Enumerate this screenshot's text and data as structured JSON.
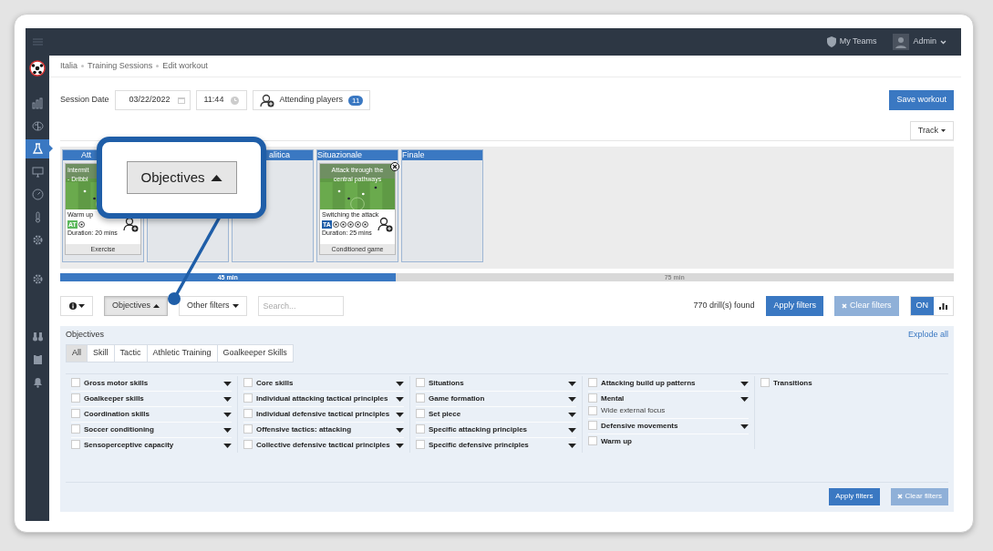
{
  "sidebar": {
    "items": [
      {
        "kind": "chart",
        "selected": false
      },
      {
        "kind": "brain",
        "selected": false
      },
      {
        "kind": "flask",
        "selected": true
      },
      {
        "kind": "monitor",
        "selected": false
      },
      {
        "kind": "gauge",
        "selected": false
      },
      {
        "kind": "thermometer",
        "selected": false
      },
      {
        "kind": "gear",
        "selected": false
      }
    ],
    "lower_items": [
      {
        "kind": "gear",
        "selected": false
      }
    ],
    "bottom_items": [
      {
        "kind": "binoculars",
        "selected": false
      },
      {
        "kind": "clipboard",
        "selected": false
      },
      {
        "kind": "bell",
        "selected": false
      }
    ]
  },
  "topbar": {
    "my_teams": "My Teams",
    "user": "Admin"
  },
  "breadcrumb": [
    "Italia",
    "Training Sessions",
    "Edit workout"
  ],
  "session": {
    "label": "Session Date",
    "date": "03/22/2022",
    "time": "11:44",
    "attending_label": "Attending players",
    "attending_count": "11"
  },
  "save_button": "Save workout",
  "track_button": "Track",
  "phases": [
    {
      "kind": "column",
      "title": "Att",
      "drills": [
        {
          "title_lines": [
            "Intermit",
            "- Dribbl"
          ],
          "category": "Warm up",
          "tag": "AT",
          "color": "#5cb85c",
          "icons": [
            {
              "kind": "ball"
            }
          ],
          "duration": "Duration: 20 mins",
          "type": "Exercise",
          "removable": false
        }
      ]
    },
    {
      "kind": "column"
    },
    {
      "kind": "column",
      "title": "alitica"
    },
    {
      "kind": "column",
      "title": "Situazionale",
      "drills": [
        {
          "title_lines": [
            "Attack through the",
            "central pathways"
          ],
          "category": "Switching the attack",
          "tag": "TA",
          "color": "#1f5ea8",
          "icons": [
            {
              "kind": "ball"
            },
            {
              "kind": "ball"
            },
            {
              "kind": "ball"
            },
            {
              "kind": "ball"
            },
            {
              "kind": "ball"
            }
          ],
          "duration": "Duration: 25 mins",
          "type": "Conditioned game",
          "removable": true
        }
      ]
    },
    {
      "kind": "column",
      "title": "Finale"
    }
  ],
  "duration_bar": {
    "level": 0.375,
    "done_label": "45 min",
    "total_label": "75 min"
  },
  "callout": {
    "label": "Objectives"
  },
  "filters": {
    "objectives_label": "Objectives",
    "objectives_open": true,
    "other_label": "Other filters",
    "search_placeholder": "Search...",
    "found": "770 drill(s) found",
    "apply": "Apply filters",
    "clear": "Clear filters",
    "toggle": {
      "label": "ON",
      "on": true
    }
  },
  "objectives_panel": {
    "title": "Objectives",
    "explode": "Explode all",
    "tabs": [
      {
        "label": "All",
        "selected": true
      },
      {
        "label": "Skill",
        "selected": false
      },
      {
        "label": "Tactic",
        "selected": false
      },
      {
        "label": "Athletic Training",
        "selected": false
      },
      {
        "label": "Goalkeeper Skills",
        "selected": false
      }
    ],
    "columns": [
      [
        {
          "label": "Gross motor skills",
          "checked": false,
          "expandable": true
        },
        {
          "label": "Goalkeeper skills",
          "checked": false,
          "expandable": true
        },
        {
          "label": "Coordination skills",
          "checked": false,
          "expandable": true
        },
        {
          "label": "Soccer conditioning",
          "checked": false,
          "expandable": true
        },
        {
          "label": "Sensoperceptive capacity",
          "checked": false,
          "expandable": true
        }
      ],
      [
        {
          "label": "Core skills",
          "checked": false,
          "expandable": true
        },
        {
          "label": "Individual attacking tactical principles",
          "checked": false,
          "expandable": true
        },
        {
          "label": "Individual defensive tactical principles",
          "checked": false,
          "expandable": true
        },
        {
          "label": "Offensive tactics: attacking",
          "checked": false,
          "expandable": true
        },
        {
          "label": "Collective defensive tactical principles",
          "checked": false,
          "expandable": true
        }
      ],
      [
        {
          "label": "Situations",
          "checked": false,
          "expandable": true
        },
        {
          "label": "Game formation",
          "checked": false,
          "expandable": true
        },
        {
          "label": "Set piece",
          "checked": false,
          "expandable": true
        },
        {
          "label": "Specific attacking principles",
          "checked": false,
          "expandable": true
        },
        {
          "label": "Specific defensive principles",
          "checked": false,
          "expandable": true
        }
      ],
      [
        {
          "label": "Attacking build up patterns",
          "checked": false,
          "expandable": true
        },
        {
          "label": "Mental",
          "checked": false,
          "expandable": true,
          "children": [
            {
              "label": "Wide external focus",
              "checked": false
            }
          ]
        },
        {
          "label": "Defensive movements",
          "checked": false,
          "expandable": true
        },
        {
          "label": "Warm up",
          "checked": false,
          "expandable": false
        }
      ],
      [
        {
          "label": "Transitions",
          "checked": false,
          "expandable": false
        }
      ]
    ],
    "apply": "Apply filters",
    "clear": "Clear filters"
  }
}
